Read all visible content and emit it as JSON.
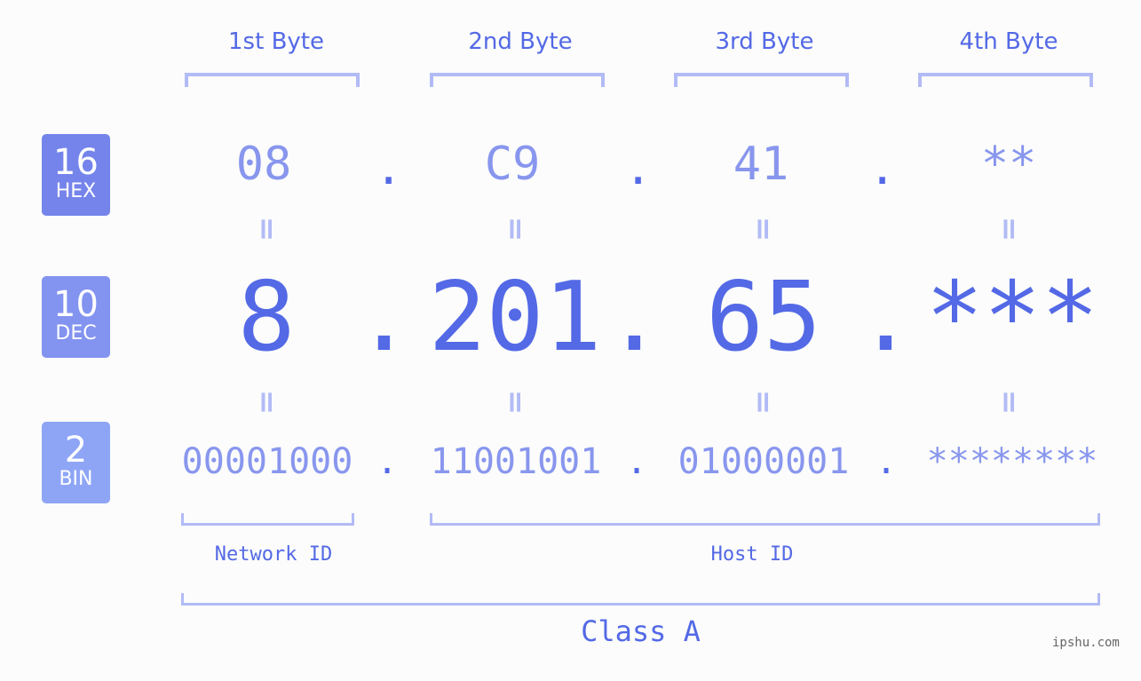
{
  "bases": [
    {
      "num": "16",
      "label": "HEX",
      "color": "#7584ea"
    },
    {
      "num": "10",
      "label": "DEC",
      "color": "#8393f0"
    },
    {
      "num": "2",
      "label": "BIN",
      "color": "#8ea5f6"
    }
  ],
  "byte_headers": [
    "1st Byte",
    "2nd Byte",
    "3rd Byte",
    "4th Byte"
  ],
  "hex": [
    "08",
    "C9",
    "41",
    "**"
  ],
  "dec": [
    "8",
    "201",
    "65",
    "***"
  ],
  "bin": [
    "00001000",
    "11001001",
    "01000001",
    "********"
  ],
  "separator": ".",
  "equals": "=",
  "network_label": "Network ID",
  "host_label": "Host ID",
  "class_label": "Class A",
  "watermark": "ipshu.com",
  "colors": {
    "accent": "#5469e6",
    "light": "#8896ee",
    "bracket": "#b2bbf5"
  }
}
